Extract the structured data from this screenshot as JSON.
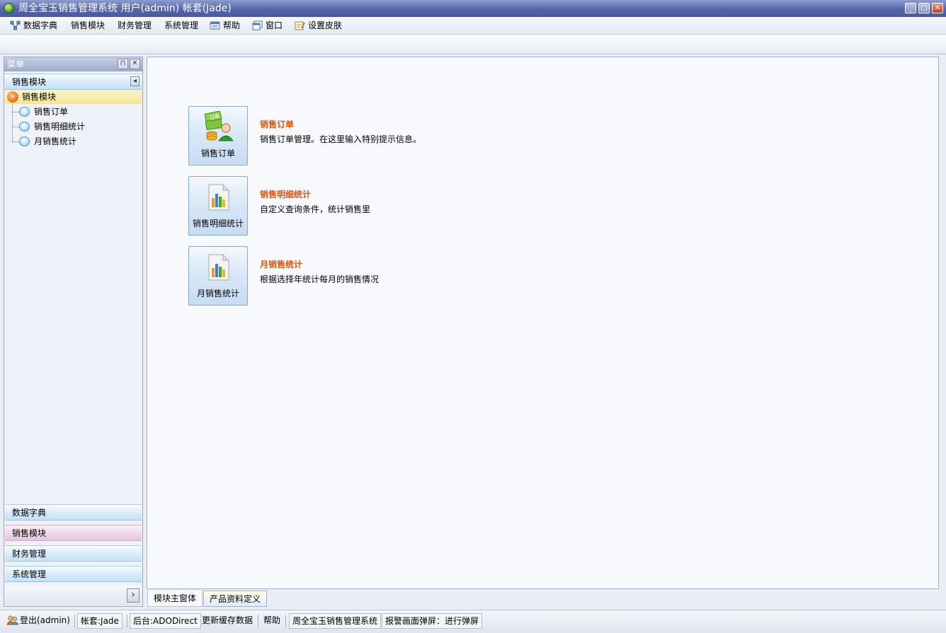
{
  "window": {
    "title": "周全宝玉销售管理系统 用户(admin) 帐套(Jade)",
    "minimize_glyph": "_",
    "maximize_glyph": "□",
    "close_glyph": "✕"
  },
  "menu": {
    "items": [
      {
        "label": "数据字典",
        "icon": "network-icon"
      },
      {
        "label": "销售模块"
      },
      {
        "label": "财务管理"
      },
      {
        "label": "系统管理"
      },
      {
        "label": "帮助",
        "icon": "help-icon"
      },
      {
        "label": "窗口",
        "icon": "window-icon"
      },
      {
        "label": "设置皮肤",
        "icon": "skin-icon"
      }
    ]
  },
  "sidebar": {
    "header": "菜单",
    "pin_glyph": "⊓",
    "close_glyph": "✕",
    "top_group": "销售模块",
    "collapse_glyph": "◂",
    "tree": {
      "root": "销售模块",
      "root_glyph": "›",
      "children": [
        "销售订单",
        "销售明细统计",
        "月销售统计"
      ]
    },
    "groups": [
      {
        "label": "数据字典",
        "active": false
      },
      {
        "label": "销售模块",
        "active": true
      },
      {
        "label": "财务管理",
        "active": false
      },
      {
        "label": "系统管理",
        "active": false
      }
    ],
    "expand_glyph": "›"
  },
  "modules": [
    {
      "button_label": "销售订单",
      "title": "销售订单",
      "desc": "销售订单管理。在这里输入特别提示信息。",
      "icon": "order-icon",
      "icon_text": "订单"
    },
    {
      "button_label": "销售明细统计",
      "title": "销售明细统计",
      "desc": "自定义查询条件，统计销售里",
      "icon": "chart-report-icon"
    },
    {
      "button_label": "月销售统计",
      "title": "月销售统计",
      "desc": "根据选择年统计每月的销售情况",
      "icon": "chart-report-icon"
    }
  ],
  "tabs": [
    {
      "label": "模块主窗体",
      "active": true
    },
    {
      "label": "产品资料定义",
      "active": false
    }
  ],
  "status": {
    "login": "登出(admin)",
    "account": "帐套:Jade",
    "backend": "后台:ADODirect",
    "refresh": "更新缓存数据",
    "help": "帮助",
    "system": "周全宝玉销售管理系统",
    "alarm": "报警画面弹屏：进行弹屏"
  },
  "colors": {
    "accent_title": "#e0540b",
    "titlebar": "#5565a8"
  }
}
